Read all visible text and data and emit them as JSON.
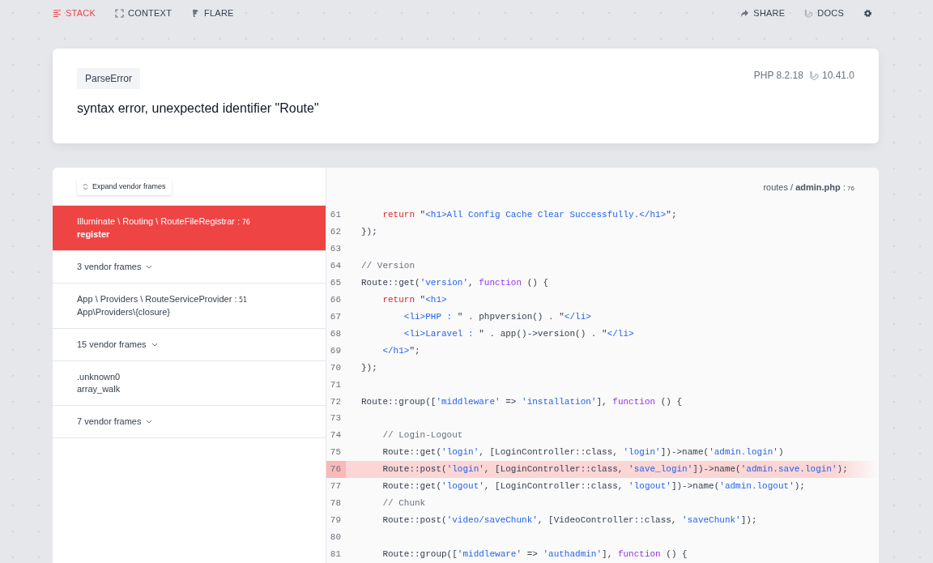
{
  "nav": {
    "left": [
      {
        "kind": "stack",
        "label": "STACK",
        "selected": true
      },
      {
        "kind": "context",
        "label": "CONTEXT",
        "selected": false
      },
      {
        "kind": "flare",
        "label": "FLARE",
        "selected": false
      }
    ],
    "right": [
      {
        "kind": "share",
        "label": "SHARE"
      },
      {
        "kind": "docs",
        "label": "DOCS"
      },
      {
        "kind": "settings"
      }
    ]
  },
  "error": {
    "type": "ParseError",
    "message": "syntax error, unexpected identifier \"Route\"",
    "php_version": "PHP 8.2.18",
    "laravel_version": "10.41.0"
  },
  "stack": {
    "expand_button": "Expand vendor frames",
    "frames": [
      {
        "kind": "frame",
        "class_path": "Illuminate \\ Routing \\ RouteFileRegistrar :",
        "line": "76",
        "method": "register",
        "selected": true
      },
      {
        "kind": "vendor",
        "label": "3 vendor frames"
      },
      {
        "kind": "frame",
        "class_path": "App \\ Providers \\ RouteServiceProvider :",
        "line": "51",
        "method": "App\\Providers\\{closure}",
        "selected": false
      },
      {
        "kind": "vendor",
        "label": "15 vendor frames"
      },
      {
        "kind": "frame",
        "class_path": ".unknown0",
        "method": "array_walk",
        "selected": false
      },
      {
        "kind": "vendor",
        "label": "7 vendor frames"
      }
    ]
  },
  "code": {
    "file_path": "routes / **admin.php** :",
    "file_line": "76",
    "lines": [
      {
        "number": "61",
        "highlighted": false,
        "tokens": [
          {
            "kind": "keyword",
            "text": "    return"
          },
          {
            "kind": "plain",
            "text": " \""
          },
          {
            "kind": "string",
            "text": "<h1>All Config Cache Clear Successfully.</h1>"
          },
          {
            "kind": "plain",
            "text": "\";"
          }
        ]
      },
      {
        "number": "62",
        "highlighted": false,
        "tokens": [
          {
            "kind": "plain",
            "text": "});"
          }
        ]
      },
      {
        "number": "63",
        "highlighted": false
      },
      {
        "number": "64",
        "highlighted": false,
        "tokens": [
          {
            "kind": "comment",
            "text": "// Version"
          }
        ]
      },
      {
        "number": "65",
        "highlighted": false,
        "tokens": [
          {
            "kind": "plain",
            "text": "Route::get("
          },
          {
            "kind": "string",
            "text": "'version'"
          },
          {
            "kind": "plain",
            "text": ", "
          },
          {
            "kind": "storage",
            "text": "function"
          },
          {
            "kind": "plain",
            "text": " () {"
          }
        ]
      },
      {
        "number": "66",
        "highlighted": false,
        "tokens": [
          {
            "kind": "keyword",
            "text": "    return"
          },
          {
            "kind": "plain",
            "text": " \""
          },
          {
            "kind": "string",
            "text": "<h1>"
          }
        ]
      },
      {
        "number": "67",
        "highlighted": false,
        "tokens": [
          {
            "kind": "string",
            "text": "        <li>PHP : "
          },
          {
            "kind": "plain",
            "text": "\" . phpversion() . \""
          },
          {
            "kind": "string",
            "text": "</li>"
          }
        ]
      },
      {
        "number": "68",
        "highlighted": false,
        "tokens": [
          {
            "kind": "string",
            "text": "        <li>Laravel : "
          },
          {
            "kind": "plain",
            "text": "\" . app()->version() . \""
          },
          {
            "kind": "string",
            "text": "</li>"
          }
        ]
      },
      {
        "number": "69",
        "highlighted": false,
        "tokens": [
          {
            "kind": "string",
            "text": "    </h1>"
          },
          {
            "kind": "plain",
            "text": "\";"
          }
        ]
      },
      {
        "number": "70",
        "highlighted": false,
        "tokens": [
          {
            "kind": "plain",
            "text": "});"
          }
        ]
      },
      {
        "number": "71",
        "highlighted": false
      },
      {
        "number": "72",
        "highlighted": false,
        "tokens": [
          {
            "kind": "plain",
            "text": "Route::group(["
          },
          {
            "kind": "string",
            "text": "'middleware'"
          },
          {
            "kind": "plain",
            "text": " => "
          },
          {
            "kind": "string",
            "text": "'installation'"
          },
          {
            "kind": "plain",
            "text": "], "
          },
          {
            "kind": "storage",
            "text": "function"
          },
          {
            "kind": "plain",
            "text": " () {"
          }
        ]
      },
      {
        "number": "73",
        "highlighted": false
      },
      {
        "number": "74",
        "highlighted": false,
        "tokens": [
          {
            "kind": "comment",
            "text": "    // Login-Logout"
          }
        ]
      },
      {
        "number": "75",
        "highlighted": false,
        "tokens": [
          {
            "kind": "plain",
            "text": "    Route::get("
          },
          {
            "kind": "string",
            "text": "'login'"
          },
          {
            "kind": "plain",
            "text": ", [LoginController::class, "
          },
          {
            "kind": "string",
            "text": "'login'"
          },
          {
            "kind": "plain",
            "text": "])->name("
          },
          {
            "kind": "string",
            "text": "'admin.login'"
          },
          {
            "kind": "plain",
            "text": ")"
          }
        ]
      },
      {
        "number": "76",
        "highlighted": true,
        "tokens": [
          {
            "kind": "plain",
            "text": "    Route::post("
          },
          {
            "kind": "string",
            "text": "'login'"
          },
          {
            "kind": "plain",
            "text": ", [LoginController::class, "
          },
          {
            "kind": "string",
            "text": "'save_login'"
          },
          {
            "kind": "plain",
            "text": "])->name("
          },
          {
            "kind": "string",
            "text": "'admin.save.login'"
          },
          {
            "kind": "plain",
            "text": ");"
          }
        ]
      },
      {
        "number": "77",
        "highlighted": false,
        "tokens": [
          {
            "kind": "plain",
            "text": "    Route::get("
          },
          {
            "kind": "string",
            "text": "'logout'"
          },
          {
            "kind": "plain",
            "text": ", [LoginController::class, "
          },
          {
            "kind": "string",
            "text": "'logout'"
          },
          {
            "kind": "plain",
            "text": "])->name("
          },
          {
            "kind": "string",
            "text": "'admin.logout'"
          },
          {
            "kind": "plain",
            "text": ");"
          }
        ]
      },
      {
        "number": "78",
        "highlighted": false,
        "tokens": [
          {
            "kind": "comment",
            "text": "    // Chunk"
          }
        ]
      },
      {
        "number": "79",
        "highlighted": false,
        "tokens": [
          {
            "kind": "plain",
            "text": "    Route::post("
          },
          {
            "kind": "string",
            "text": "'video/saveChunk'"
          },
          {
            "kind": "plain",
            "text": ", [VideoController::class, "
          },
          {
            "kind": "string",
            "text": "'saveChunk'"
          },
          {
            "kind": "plain",
            "text": "]);"
          }
        ]
      },
      {
        "number": "80",
        "highlighted": false
      },
      {
        "number": "81",
        "highlighted": false,
        "tokens": [
          {
            "kind": "plain",
            "text": "    Route::group(["
          },
          {
            "kind": "string",
            "text": "'middleware'"
          },
          {
            "kind": "plain",
            "text": " => "
          },
          {
            "kind": "string",
            "text": "'authadmin'"
          },
          {
            "kind": "plain",
            "text": "], "
          },
          {
            "kind": "storage",
            "text": "function"
          },
          {
            "kind": "plain",
            "text": " () {"
          }
        ]
      }
    ]
  }
}
